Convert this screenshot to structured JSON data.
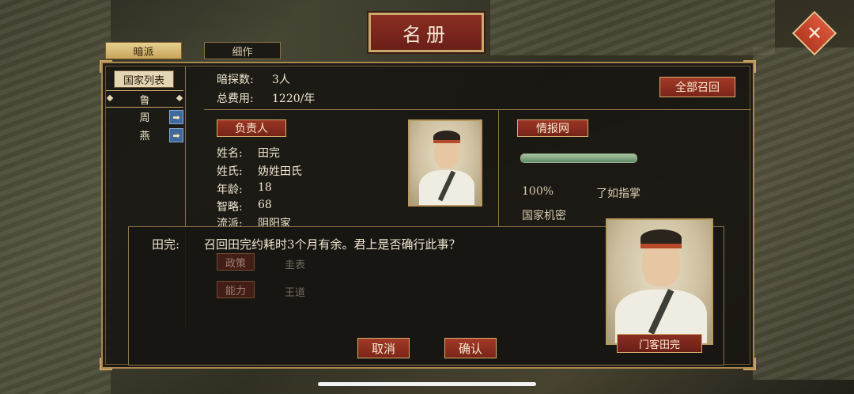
{
  "window": {
    "title": "名册",
    "close_symbol": "✕"
  },
  "tabs": [
    {
      "label": "暗派",
      "active": true
    },
    {
      "label": "细作",
      "active": false
    }
  ],
  "sidebar": {
    "header": "国家列表",
    "items": [
      {
        "label": "鲁",
        "selected": true
      },
      {
        "label": "周",
        "selected": false,
        "arrow": "➡"
      },
      {
        "label": "燕",
        "selected": false,
        "arrow": "➡"
      }
    ]
  },
  "summary": {
    "spies_label": "暗探数:",
    "spies_value": "3人",
    "cost_label": "总费用:",
    "cost_value": "1220/年",
    "recall_all_label": "全部召回"
  },
  "leader": {
    "section_label": "负责人",
    "fields": [
      {
        "label": "姓名:",
        "value": "田完"
      },
      {
        "label": "姓氏:",
        "value": "妫姓田氏"
      },
      {
        "label": "年龄:",
        "value": "18"
      },
      {
        "label": "智略:",
        "value": "68"
      },
      {
        "label": "流派:",
        "value": "阴阳家"
      }
    ],
    "hidden_tags": [
      {
        "label": "政策",
        "value": "圭表"
      },
      {
        "label": "能力",
        "value": "王道"
      }
    ]
  },
  "intel": {
    "section_label": "情报网",
    "progress": 1.0,
    "percent_text": "100%",
    "level_text": "了如指掌",
    "subject_text": "国家机密"
  },
  "dialog": {
    "speaker": "田完:",
    "message": "召回田完约耗时3个月有余。君上是否确行此事？",
    "cancel_label": "取消",
    "confirm_label": "确认",
    "nameplate": "门客田完"
  },
  "colors": {
    "accent_red": "#8a2e22",
    "gold_border": "#c9a969",
    "progress_green": "#7fa67a"
  }
}
